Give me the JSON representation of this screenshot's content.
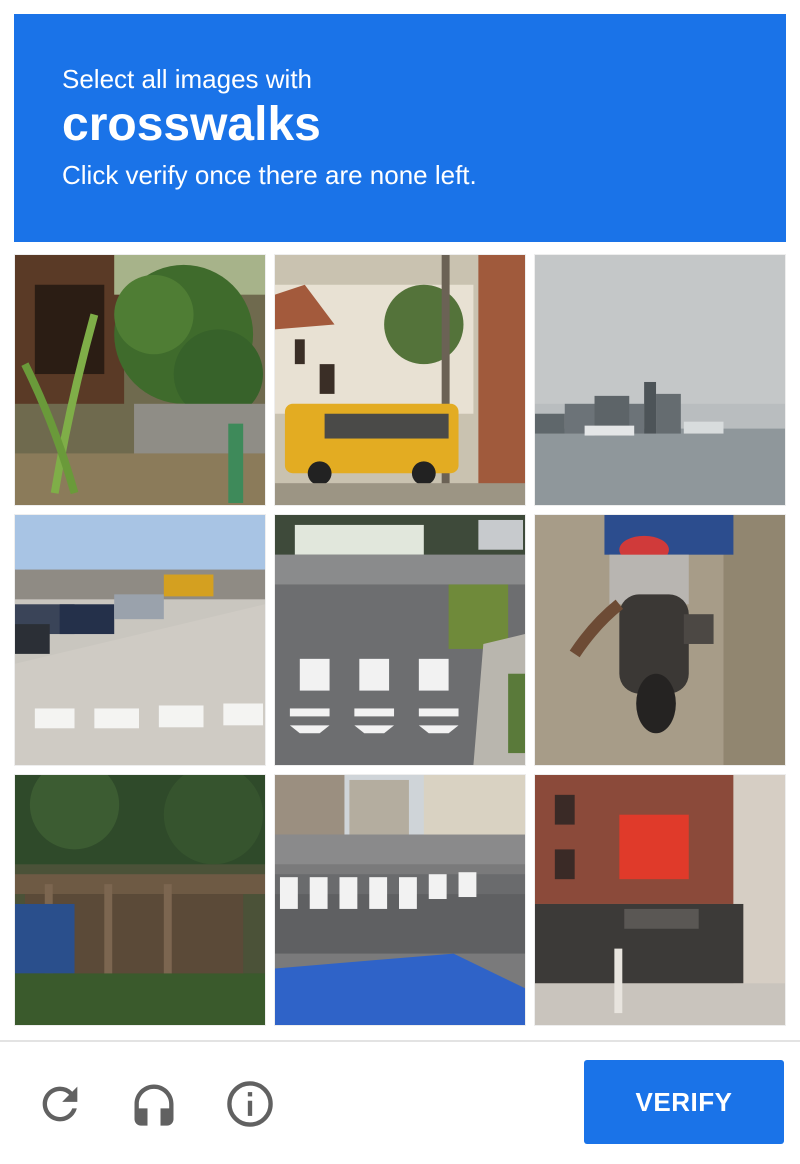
{
  "header": {
    "prompt": "Select all images with",
    "keyword": "crosswalks",
    "instruction": "Click verify once there are none left."
  },
  "tiles": [
    {
      "description": "yard with banana plant and shrubs",
      "selected": false
    },
    {
      "description": "yellow bus on village street",
      "selected": false
    },
    {
      "description": "harbor skyline over water",
      "selected": false
    },
    {
      "description": "street with parked cars and crosswalk",
      "selected": false
    },
    {
      "description": "road with zebra crosswalk",
      "selected": false
    },
    {
      "description": "motorcycle rear on dirt road",
      "selected": false
    },
    {
      "description": "overgrown wooden shack",
      "selected": false
    },
    {
      "description": "city intersection with crosswalk",
      "selected": false
    },
    {
      "description": "brick storefront building",
      "selected": false
    }
  ],
  "footer": {
    "reload_icon": "reload-icon",
    "audio_icon": "headphones-icon",
    "info_icon": "info-icon",
    "verify_label": "VERIFY"
  },
  "colors": {
    "accent": "#1a73e8",
    "icon_gray": "#616161"
  }
}
